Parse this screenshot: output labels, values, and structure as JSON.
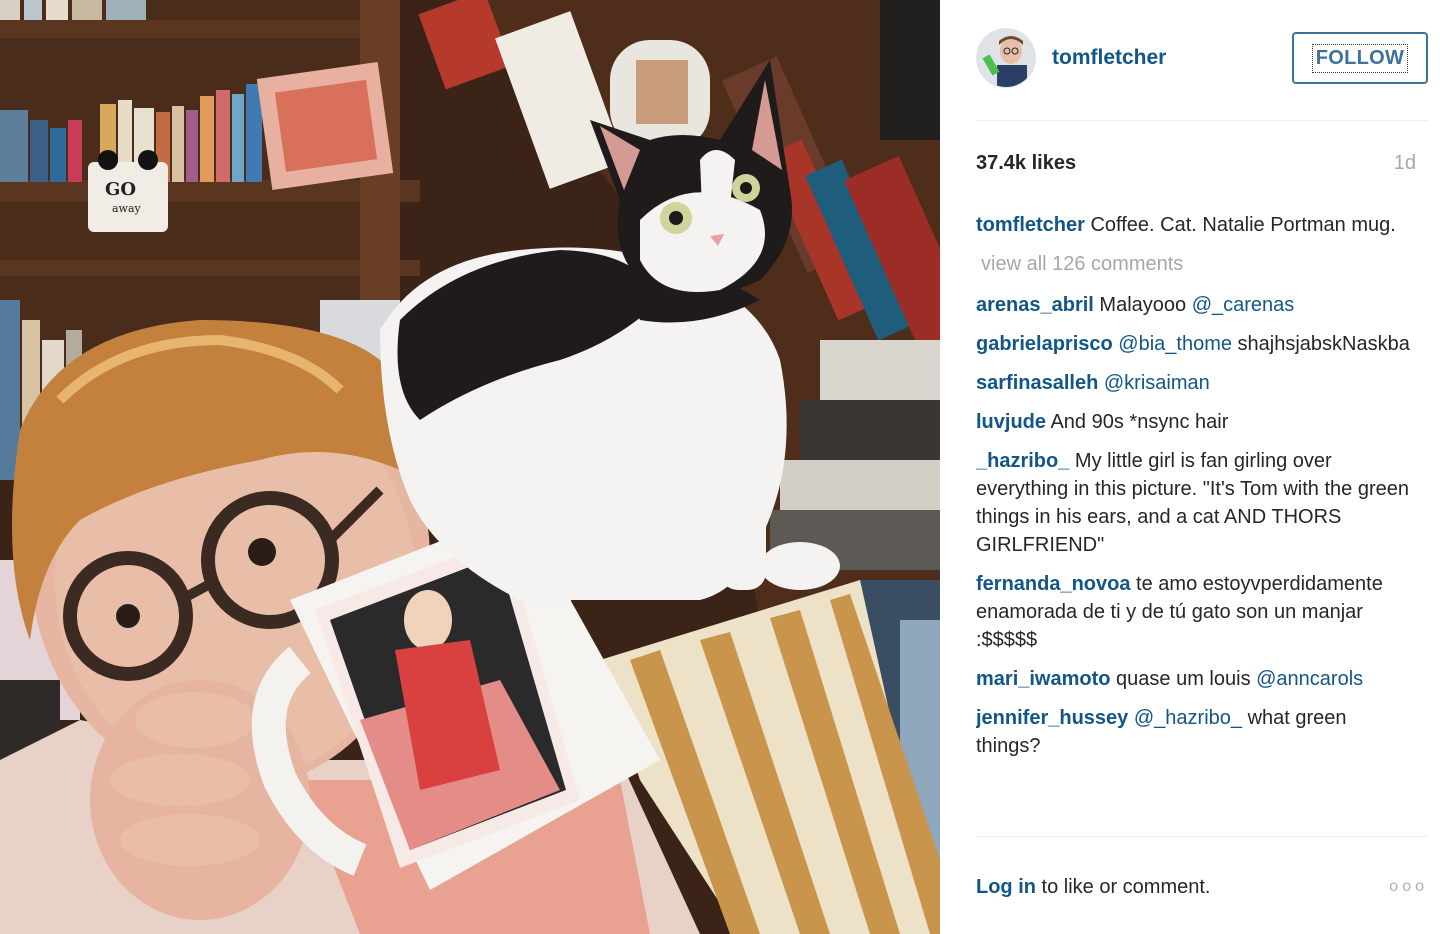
{
  "post": {
    "username": "tomfletcher",
    "follow_label": "FOLLOW",
    "likes": "37.4k likes",
    "time": "1d",
    "caption_user": "tomfletcher",
    "caption_text": "Coffee. Cat. Natalie Portman mug.",
    "view_all": "view all 126 comments"
  },
  "comments": [
    {
      "user": "arenas_abril",
      "text": "Malayooo ",
      "mention": "@_carenas",
      "after": ""
    },
    {
      "user": "gabrielaprisco",
      "text": "",
      "mention": "@bia_thome",
      "after": " shajhsjabskNaskba"
    },
    {
      "user": "sarfinasalleh",
      "text": "",
      "mention": "@krisaiman",
      "after": ""
    },
    {
      "user": "luvjude",
      "text": "And 90s *nsync hair",
      "mention": "",
      "after": ""
    },
    {
      "user": "_hazribo_",
      "text": "My little girl is fan girling over everything in this picture. \"It's Tom with the green things in his ears, and a cat AND THORS GIRLFRIEND\"",
      "mention": "",
      "after": ""
    },
    {
      "user": "fernanda_novoa",
      "text": "te amo estoyvperdidamente enamorada de ti y de tú gato son un manjar :$$$$$",
      "mention": "",
      "after": ""
    },
    {
      "user": "mari_iwamoto",
      "text": "quase um louis ",
      "mention": "@anncarols",
      "after": ""
    },
    {
      "user": "jennifer_hussey",
      "text": "",
      "mention": "@_hazribo_",
      "after": " what green things?"
    }
  ],
  "footer": {
    "login_link": "Log in",
    "login_rest": " to like or comment.",
    "more_icon": "ooo"
  },
  "colors": {
    "link_blue": "#125688",
    "follow_blue": "#3f729b",
    "muted_gray": "#a5a7aa"
  }
}
